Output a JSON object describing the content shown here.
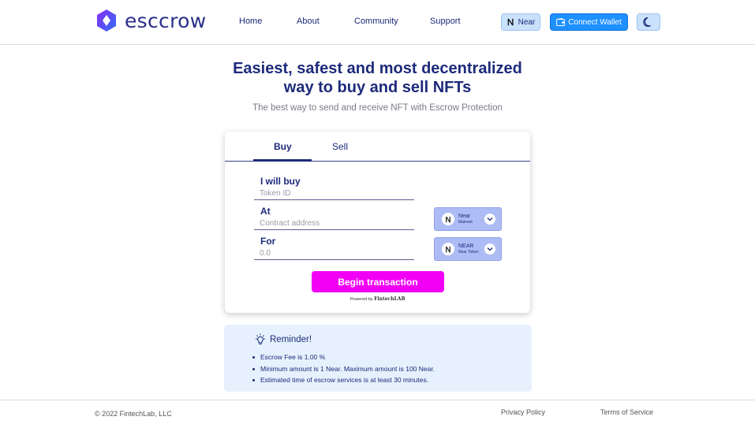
{
  "brand": {
    "name": "esccrow",
    "gradient_from": "#7b2ff7",
    "gradient_to": "#2f6df6"
  },
  "nav": {
    "items": [
      "Home",
      "About",
      "Community",
      "Support"
    ]
  },
  "header_actions": {
    "network_label": "Near",
    "network_icon": "near-icon",
    "wallet_label": "Connect Wallet",
    "wallet_icon": "wallet-icon",
    "theme_icon": "moon-icon"
  },
  "hero": {
    "title_line1": "Easiest, safest and most decentralized",
    "title_line2": "way to buy and sell NFTs",
    "subtitle": "The best way to send and receive NFT with Escrow Protection"
  },
  "card": {
    "tabs": [
      {
        "label": "Buy",
        "active": true
      },
      {
        "label": "Sell",
        "active": false
      }
    ],
    "fields": {
      "buy": {
        "label": "I will buy",
        "placeholder": "Token ID",
        "value": ""
      },
      "at": {
        "label": "At",
        "placeholder": "Contract address",
        "value": ""
      },
      "for": {
        "label": "For",
        "placeholder": "0.0",
        "value": ""
      }
    },
    "network_select": {
      "main": "Near",
      "sub": "Mainnet"
    },
    "token_select": {
      "main": "NEAR",
      "sub": "Near Token"
    },
    "submit_label": "Begin transaction",
    "powered_prefix": "Powered by",
    "powered_brand": "FintechLAB"
  },
  "reminder": {
    "title": "Reminder!",
    "icon": "lightbulb-icon",
    "items": [
      "Escrow Fee is 1.00 %",
      "Minimum amount is 1 Near. Maximum amount is 100 Near.",
      "Estimated time of escrow services is at least 30 minutes."
    ]
  },
  "footer": {
    "copyright": "© 2022 FintechLab, LLC",
    "links": [
      "Privacy Policy",
      "Terms of Service"
    ]
  },
  "colors": {
    "primary_text": "#1d2a7a",
    "accent_magenta": "#f200f5",
    "wallet_blue": "#1e90ff",
    "light_blue": "#c9e1fb",
    "reminder_bg": "#e6f1fd",
    "selector_bg": "#aebcf5"
  }
}
